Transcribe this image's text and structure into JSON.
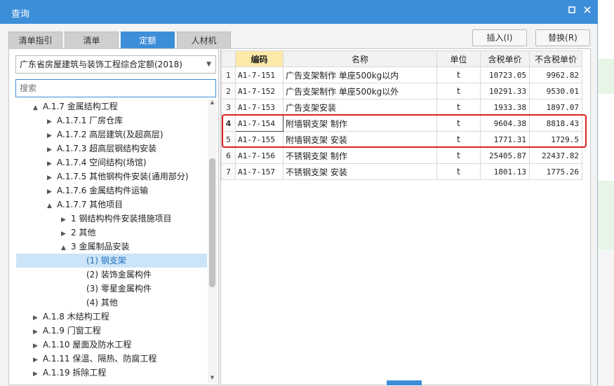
{
  "window": {
    "title": "查询"
  },
  "tabs": [
    {
      "label": "清单指引"
    },
    {
      "label": "清单"
    },
    {
      "label": "定额"
    },
    {
      "label": "人材机"
    }
  ],
  "buttons": {
    "insert": "插入(I)",
    "replace": "替换(R)"
  },
  "library_select": {
    "value": "广东省房屋建筑与装饰工程综合定额(2018)"
  },
  "search": {
    "placeholder": "搜索"
  },
  "tree": [
    {
      "label": "A.1.7 金属结构工程",
      "toggle": "▲"
    },
    {
      "label": "A.1.7.1 厂房仓库",
      "toggle": "▶"
    },
    {
      "label": "A.1.7.2 高层建筑(及超高层)",
      "toggle": "▶"
    },
    {
      "label": "A.1.7.3 超高层钢结构安装",
      "toggle": "▶"
    },
    {
      "label": "A.1.7.4 空间结构(场馆)",
      "toggle": "▶"
    },
    {
      "label": "A.1.7.5 其他钢构件安装(通用部分)",
      "toggle": "▶"
    },
    {
      "label": "A.1.7.6 金属结构件运输",
      "toggle": "▶"
    },
    {
      "label": "A.1.7.7 其他项目",
      "toggle": "▲"
    },
    {
      "label": "1 钢结构构件安装措施项目",
      "toggle": "▶"
    },
    {
      "label": "2 其他",
      "toggle": "▶"
    },
    {
      "label": "3 金属制品安装",
      "toggle": "▲"
    },
    {
      "label": "(1) 钢支架",
      "toggle": ""
    },
    {
      "label": "(2) 装饰金属构件",
      "toggle": ""
    },
    {
      "label": "(3) 零星金属构件",
      "toggle": ""
    },
    {
      "label": "(4) 其他",
      "toggle": ""
    },
    {
      "label": "A.1.8 木结构工程",
      "toggle": "▶"
    },
    {
      "label": "A.1.9 门窗工程",
      "toggle": "▶"
    },
    {
      "label": "A.1.10 屋面及防水工程",
      "toggle": "▶"
    },
    {
      "label": "A.1.11 保温、隔热、防腐工程",
      "toggle": "▶"
    },
    {
      "label": "A.1.19 拆除工程",
      "toggle": "▶"
    }
  ],
  "table": {
    "headers": [
      "",
      "编码",
      "名称",
      "单位",
      "含税单价",
      "不含税单价"
    ],
    "rows": [
      {
        "idx": "1",
        "code": "A1-7-151",
        "name": "广告支架制作 单座500kg以内",
        "unit": "t",
        "tax": "10723.05",
        "notax": "9962.82"
      },
      {
        "idx": "2",
        "code": "A1-7-152",
        "name": "广告支架制作 单座500kg以外",
        "unit": "t",
        "tax": "10291.33",
        "notax": "9530.01"
      },
      {
        "idx": "3",
        "code": "A1-7-153",
        "name": "广告支架安装",
        "unit": "t",
        "tax": "1933.38",
        "notax": "1897.07"
      },
      {
        "idx": "4",
        "code": "A1-7-154",
        "name": "附墙钢支架 制作",
        "unit": "t",
        "tax": "9604.38",
        "notax": "8818.43"
      },
      {
        "idx": "5",
        "code": "A1-7-155",
        "name": "附墙钢支架 安装",
        "unit": "t",
        "tax": "1771.31",
        "notax": "1729.5"
      },
      {
        "idx": "6",
        "code": "A1-7-156",
        "name": "不锈钢支架 制作",
        "unit": "t",
        "tax": "25405.87",
        "notax": "22437.82"
      },
      {
        "idx": "7",
        "code": "A1-7-157",
        "name": "不锈钢支架 安装",
        "unit": "t",
        "tax": "1801.13",
        "notax": "1775.26"
      }
    ]
  },
  "colors": {
    "accent": "#3d8ed9",
    "highlight_box": "#e02020",
    "selected_row": "#cce4f7",
    "code_header": "#fde9a8"
  }
}
